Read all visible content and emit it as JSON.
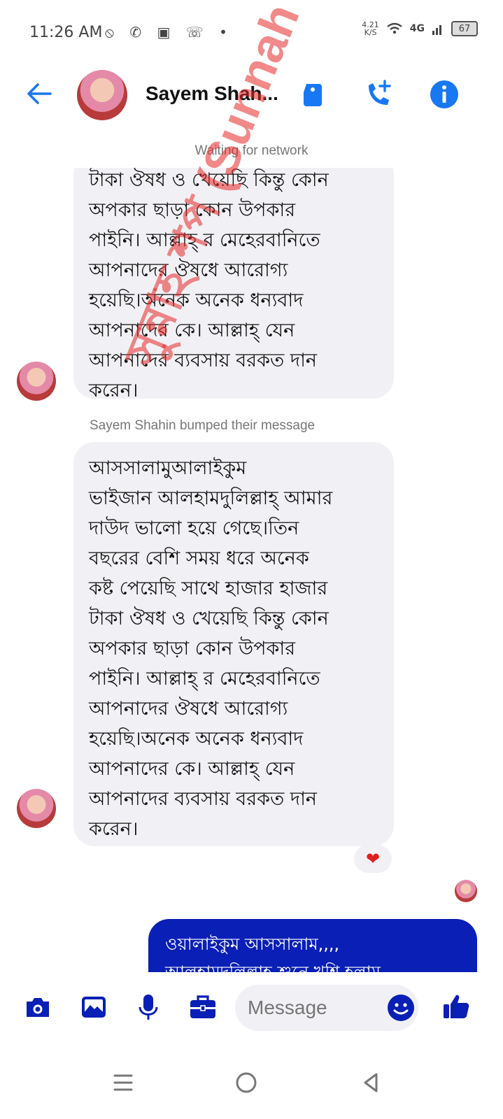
{
  "status_bar": {
    "time": "11:26 AM",
    "left_icons": "⦸ ✆ ▣ ☏ •",
    "speed_value": "4.21",
    "speed_unit": "K/S",
    "network": "4G",
    "battery": "67"
  },
  "header": {
    "contact_name": "Sayem Shah...",
    "icons": [
      "back-arrow-icon",
      "tag-icon",
      "add-call-icon",
      "info-icon"
    ]
  },
  "network_status": "Waiting for network",
  "messages": [
    {
      "direction": "incoming",
      "partial": true,
      "lines": [
        "টাকা ঔষধ ও খেয়েছি কিন্তু কোন",
        "অপকার ছাড়া কোন উপকার",
        "পাইনি। আল্লাহ্ র মেহেরবানিতে",
        "আপনাদের ঔষধে আরোগ্য",
        "হয়েছি।অনেক অনেক ধন্যবাদ",
        "আপনাদের কে। আল্লাহ্ যেন",
        "আপনাদের ব্যবসায় বরকত দান",
        "করেন।"
      ]
    },
    {
      "direction": "incoming",
      "bump_notice": "Sayem Shahin bumped their message",
      "lines": [
        "আসসালামুআলাইকুম",
        "ভাইজান আলহামদুলিল্লাহ্ আমার",
        "দাউদ ভালো হয়ে গেছে।তিন",
        "বছরের বেশি সময় ধরে অনেক",
        "কষ্ট পেয়েছি সাথে হাজার হাজার",
        "টাকা ঔষধ ও খেয়েছি কিন্তু কোন",
        "অপকার ছাড়া কোন উপকার",
        "পাইনি। আল্লাহ্ র মেহেরবানিতে",
        "আপনাদের ঔষধে আরোগ্য",
        "হয়েছি।অনেক অনেক ধন্যবাদ",
        "আপনাদের কে। আল্লাহ্ যেন",
        "আপনাদের ব্যবসায় বরকত দান",
        "করেন।"
      ],
      "reaction": "❤"
    },
    {
      "direction": "outgoing",
      "partial": true,
      "lines": [
        "ওয়ালাইকুম আসসালাম,,,,",
        "আলহামদুলিল্লাহ শুনে খুশি হলাম"
      ]
    }
  ],
  "watermark": "সুন্নাহ শপ (Sunnah shop)",
  "composer": {
    "placeholder": "Message",
    "icons": [
      "camera-icon",
      "image-icon",
      "microphone-icon",
      "briefcase-icon",
      "emoji-icon",
      "thumbs-up-icon"
    ]
  },
  "colors": {
    "accent": "#1877f2",
    "outgoing_bubble": "#0a1fb5",
    "incoming_bubble": "#f1f1f5",
    "watermark": "#e62828"
  }
}
